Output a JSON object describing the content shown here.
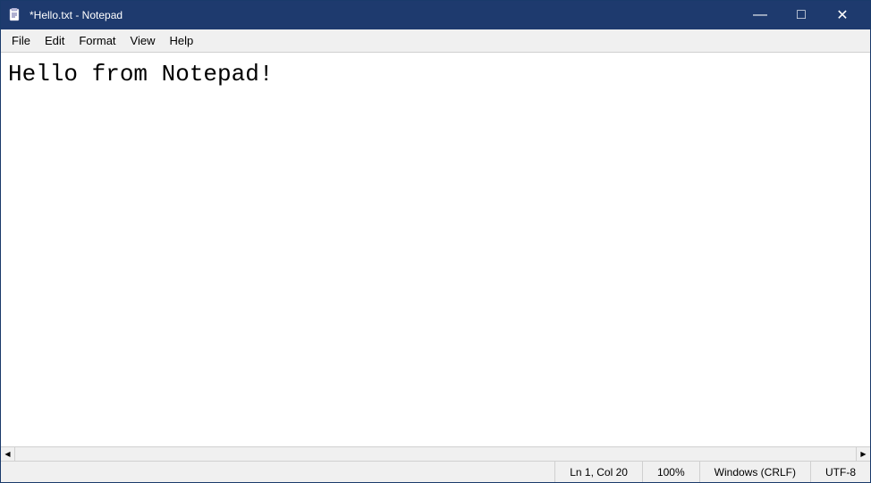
{
  "window": {
    "title": "*Hello.txt - Notepad",
    "icon": "notepad-icon"
  },
  "titlebar": {
    "minimize_label": "—",
    "maximize_label": "□",
    "close_label": "✕"
  },
  "menubar": {
    "items": [
      {
        "id": "file",
        "label": "File"
      },
      {
        "id": "edit",
        "label": "Edit"
      },
      {
        "id": "format",
        "label": "Format"
      },
      {
        "id": "view",
        "label": "View"
      },
      {
        "id": "help",
        "label": "Help"
      }
    ]
  },
  "editor": {
    "content": "Hello from Notepad!"
  },
  "statusbar": {
    "position": "Ln 1, Col 20",
    "zoom": "100%",
    "line_ending": "Windows (CRLF)",
    "encoding": "UTF-8"
  },
  "scrollbar": {
    "left_arrow": "◀",
    "right_arrow": "▶"
  }
}
